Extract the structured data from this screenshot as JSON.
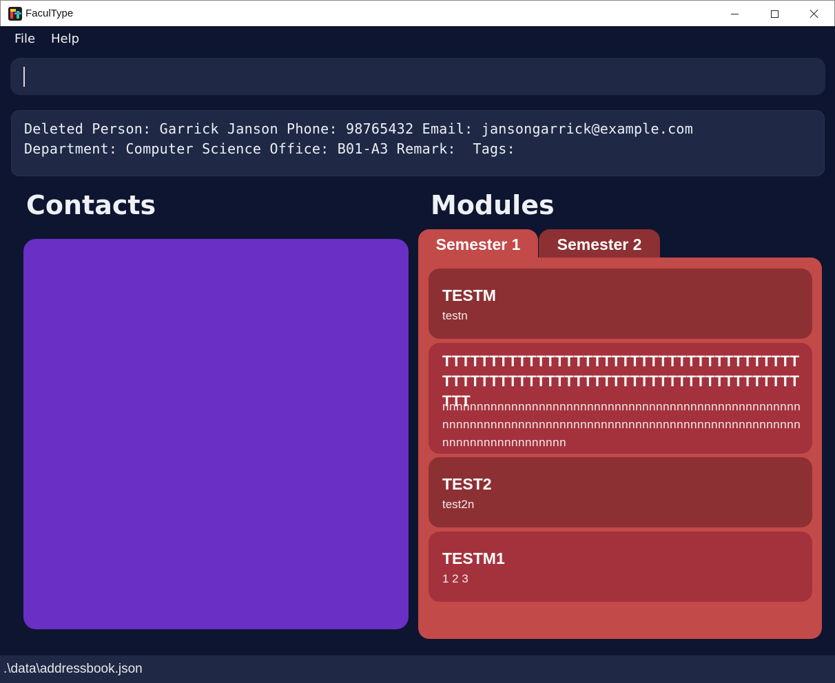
{
  "window": {
    "title": "FaculType",
    "icon": "faculty-app-icon",
    "controls": [
      "minimize-icon",
      "maximize-icon",
      "close-icon"
    ]
  },
  "menu": {
    "file": "File",
    "help": "Help"
  },
  "command": {
    "value": ""
  },
  "result": {
    "line1": "Deleted Person: Garrick Janson Phone: 98765432 Email: jansongarrick@example.com",
    "line2": "Department: Computer Science Office: B01-A3 Remark:  Tags:"
  },
  "headings": {
    "contacts": "Contacts",
    "modules": "Modules"
  },
  "tabs": [
    {
      "label": "Semester 1",
      "selected": true
    },
    {
      "label": "Semester 2",
      "selected": false
    }
  ],
  "modules": [
    {
      "code": "TESTM",
      "name": "testn"
    },
    {
      "code": "TTTTTTTTTTTTTTTTTTTTTTTTTTTTTTTTTTTTTTTTTTTTTTTTTTTTTTTTTTTTTTTTTTTTTTTTTTTTTTT",
      "name": "nnnnnnnnnnnnnnnnnnnnnnnnnnnnnnnnnnnnnnnnnnnnnnnnnnnnnnnnnnnnnnnnnnnnnnnnnnnnnnnnnnnnnnnnnnnnnnnnnnnnnnnnnnnnnnnnnnnnnnnnnn"
    },
    {
      "code": "TEST2",
      "name": "test2n"
    },
    {
      "code": "TESTM1",
      "name": "1 2 3"
    }
  ],
  "status": {
    "file_path": ".\\data\\addressbook.json"
  },
  "colors": {
    "background": "#0d1530",
    "panel": "#1f2946",
    "contacts_panel": "#6a2fc4",
    "modules_panel": "#c24a48",
    "card_dark": "#8d3033",
    "card_mid": "#a4323d"
  }
}
